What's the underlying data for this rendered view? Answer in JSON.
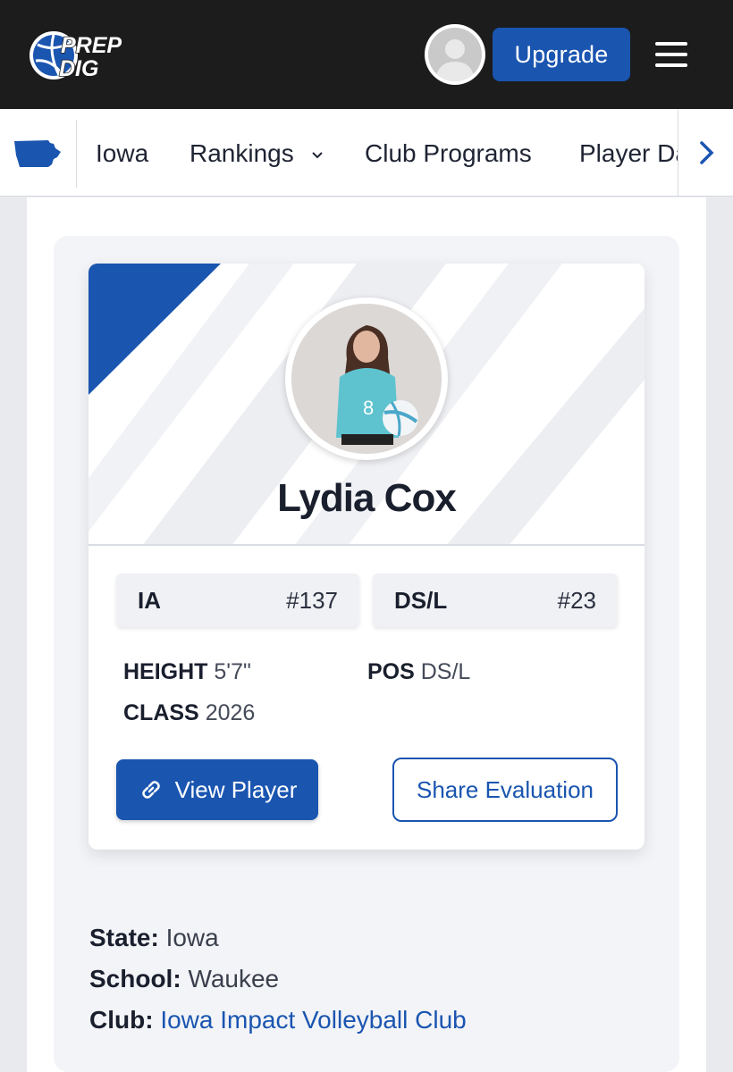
{
  "header": {
    "logo_line1": "PREP",
    "logo_line2": "DIG",
    "upgrade_label": "Upgrade",
    "colors": {
      "bar": "#1c1c1c",
      "accent": "#1a55b0"
    },
    "icons": {
      "avatar": "user-avatar-icon",
      "menu": "hamburger-menu-icon"
    }
  },
  "subnav": {
    "state_icon": "iowa-state-icon",
    "items": [
      {
        "label": "Iowa"
      },
      {
        "label": "Rankings",
        "has_dropdown": true
      },
      {
        "label": "Club Programs"
      },
      {
        "label": "Player Da"
      }
    ],
    "next_icon": "chevron-right-icon"
  },
  "player": {
    "name": "Lydia Cox",
    "rankings": [
      {
        "label": "IA",
        "value": "#137"
      },
      {
        "label": "DS/L",
        "value": "#23"
      }
    ],
    "stats": {
      "height_label": "HEIGHT",
      "height_value": "5'7\"",
      "pos_label": "POS",
      "pos_value": "DS/L",
      "class_label": "CLASS",
      "class_value": "2026"
    },
    "view_player_label": "View Player",
    "share_label": "Share Evaluation"
  },
  "details": {
    "state_label": "State:",
    "state_value": "Iowa",
    "school_label": "School:",
    "school_value": "Waukee",
    "club_label": "Club:",
    "club_value": "Iowa Impact Volleyball Club"
  }
}
